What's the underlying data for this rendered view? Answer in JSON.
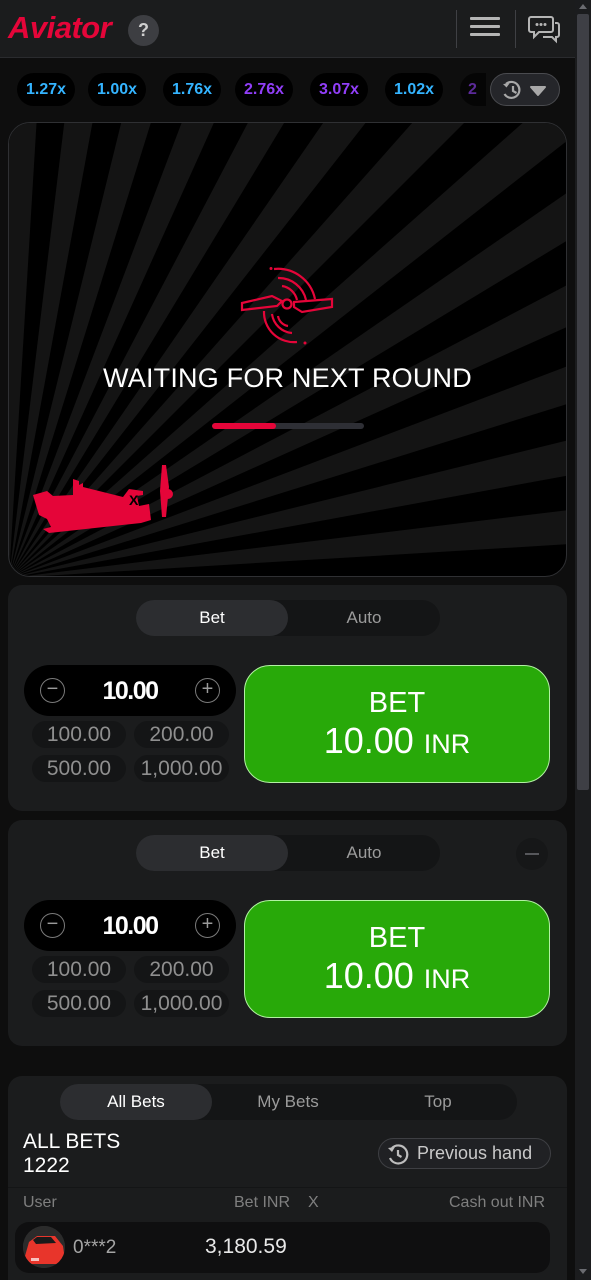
{
  "header": {
    "logo": "Aviator",
    "help_label": "?"
  },
  "history": {
    "multipliers": [
      {
        "value": "1.27x",
        "color": "#34b4ff"
      },
      {
        "value": "1.00x",
        "color": "#34b4ff"
      },
      {
        "value": "1.76x",
        "color": "#34b4ff"
      },
      {
        "value": "2.76x",
        "color": "#913ef8"
      },
      {
        "value": "3.07x",
        "color": "#913ef8"
      },
      {
        "value": "1.02x",
        "color": "#34b4ff"
      },
      {
        "value": "2",
        "color": "#913ef8"
      }
    ]
  },
  "game": {
    "status_text": "WAITING FOR NEXT ROUND",
    "progress": 0.42,
    "accent": "#e50539"
  },
  "bet_panels": [
    {
      "tabs": [
        "Bet",
        "Auto"
      ],
      "active_tab": "Bet",
      "amount": "10.00",
      "quick_amounts": [
        "100.00",
        "200.00",
        "500.00",
        "1,000.00"
      ],
      "button_label": "BET",
      "button_amount": "10.00",
      "button_currency": "INR"
    },
    {
      "tabs": [
        "Bet",
        "Auto"
      ],
      "active_tab": "Bet",
      "amount": "10.00",
      "quick_amounts": [
        "100.00",
        "200.00",
        "500.00",
        "1,000.00"
      ],
      "button_label": "BET",
      "button_amount": "10.00",
      "button_currency": "INR"
    }
  ],
  "bets": {
    "tabs": [
      "All Bets",
      "My Bets",
      "Top"
    ],
    "active_tab": "All Bets",
    "title": "ALL BETS",
    "count": "1222",
    "previous_hand_label": "Previous hand",
    "columns": [
      "User",
      "Bet INR",
      "X",
      "Cash out INR"
    ],
    "rows": [
      {
        "user": "0***2",
        "bet": "3,180.59",
        "x": "",
        "cashout": ""
      }
    ]
  }
}
